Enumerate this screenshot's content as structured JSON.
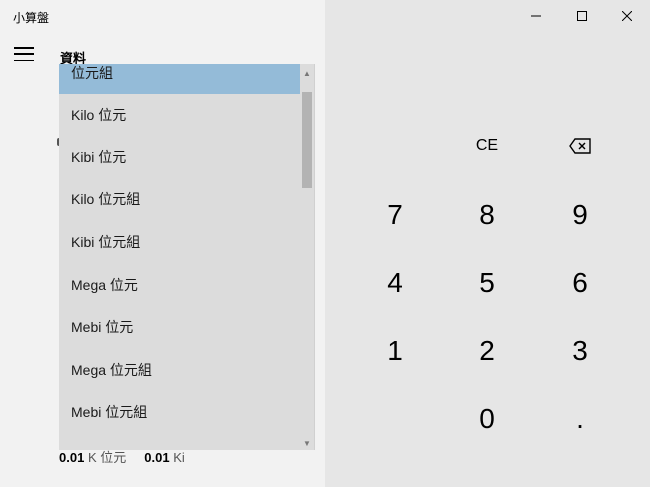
{
  "window": {
    "title": "小算盤",
    "minimize_glyph": "—",
    "maximize_glyph": "☐",
    "close_glyph": "✕"
  },
  "header": {
    "mode_title": "資料"
  },
  "dropdown": {
    "selected": "位元組",
    "items": [
      "位元組",
      "Kilo 位元",
      "Kibi 位元",
      "Kilo 位元組",
      "Kibi 位元組",
      "Mega 位元",
      "Mebi 位元",
      "Mega 位元組",
      "Mebi 位元組"
    ],
    "scroll_up_glyph": "▲",
    "scroll_down_glyph": "▼"
  },
  "footer": {
    "value1": "0.01",
    "unit1": "K 位元",
    "value2": "0.01",
    "unit2": "Ki"
  },
  "keypad": {
    "ce": "CE",
    "backspace_icon": "backspace-icon",
    "seven": "7",
    "eight": "8",
    "nine": "9",
    "four": "4",
    "five": "5",
    "six": "6",
    "one": "1",
    "two": "2",
    "three": "3",
    "zero": "0",
    "decimal": "."
  }
}
